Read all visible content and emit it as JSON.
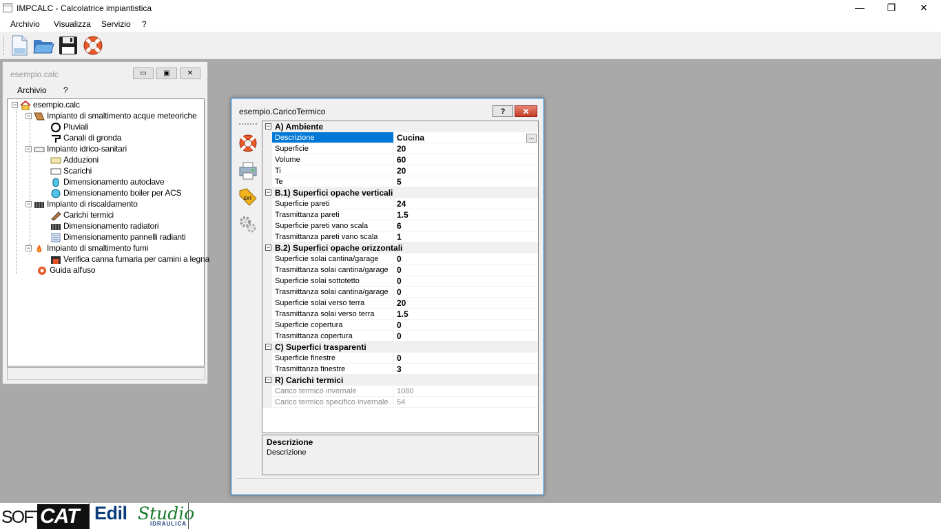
{
  "app": {
    "title": "IMPCALC - Calcolatrice impiantistica",
    "window_controls": {
      "minimize": "—",
      "restore": "❐",
      "close": "✕"
    }
  },
  "menu": [
    "Archivio",
    "Visualizza",
    "Servizio",
    "?"
  ],
  "toolbar": {
    "icons": [
      "new-file-icon",
      "open-folder-icon",
      "save-icon",
      "help-lifebuoy-icon"
    ]
  },
  "explorer": {
    "title": "esempio.calc",
    "menu": [
      "Archivio",
      "?"
    ],
    "tree": {
      "root": "esempio.calc",
      "n1": "Impianto di smaltimento acque meteoriche",
      "n1a": "Pluviali",
      "n1b": "Canali di gronda",
      "n2": "Impianto idrico-sanitari",
      "n2a": "Adduzioni",
      "n2b": "Scarichi",
      "n2c": "Dimensionamento autoclave",
      "n2d": "Dimensionamento boiler per ACS",
      "n3": "Impianto di riscaldamento",
      "n3a": "Carichi termici",
      "n3b": "Dimensionamento radiatori",
      "n3c": "Dimensionamento pannelli radianti",
      "n4": "Impianto di smaltimento fumi",
      "n4a": "Verifica canna fumaria per camini a legna",
      "n5": "Guida all'uso"
    }
  },
  "dialog": {
    "title": "esempio.CaricoTermico",
    "help": "?",
    "close": "✕",
    "ellipsis": "...",
    "categories": {
      "a": "A) Ambiente",
      "b1": "B.1) Superfici opache verticali",
      "b2": "B.2) Superfici opache orizzontali",
      "c": "C) Superfici trasparenti",
      "r": "R) Carichi termici"
    },
    "props": {
      "descrizione": {
        "name": "Descrizione",
        "value": "Cucina"
      },
      "superficie": {
        "name": "Superficie",
        "value": "20"
      },
      "volume": {
        "name": "Volume",
        "value": "60"
      },
      "ti": {
        "name": "Ti",
        "value": "20"
      },
      "te": {
        "name": "Te",
        "value": "5"
      },
      "sup_pareti": {
        "name": "Superficie pareti",
        "value": "24"
      },
      "tr_pareti": {
        "name": "Trasmittanza pareti",
        "value": "1.5"
      },
      "sup_pareti_vs": {
        "name": "Superficie pareti vano scala",
        "value": "6"
      },
      "tr_pareti_vs": {
        "name": "Trasmittanza pareti vano scala",
        "value": "1"
      },
      "sup_solai_cg": {
        "name": "Superficie solai cantina/garage",
        "value": "0"
      },
      "tr_solai_cg": {
        "name": "Trasmittanza solai cantina/garage",
        "value": "0"
      },
      "sup_solai_st": {
        "name": "Superficie solai sottotetto",
        "value": "0"
      },
      "tr_solai_cg2": {
        "name": "Trasmittanza solai cantina/garage",
        "value": "0"
      },
      "sup_solai_terra": {
        "name": "Superficie solai verso terra",
        "value": "20"
      },
      "tr_solai_terra": {
        "name": "Trasmittanza solai verso terra",
        "value": "1.5"
      },
      "sup_copertura": {
        "name": "Superficie copertura",
        "value": "0"
      },
      "tr_copertura": {
        "name": "Trasmittanza copertura",
        "value": "0"
      },
      "sup_finestre": {
        "name": "Superficie finestre",
        "value": "0"
      },
      "tr_finestre": {
        "name": "Trasmittanza finestre",
        "value": "3"
      },
      "carico_inv": {
        "name": "Carico termico invernale",
        "value": "1080"
      },
      "carico_spec": {
        "name": "Carico termico specifico invernale",
        "value": "54"
      }
    },
    "description_pane": {
      "title": "Descrizione",
      "text": "Descrizione"
    }
  },
  "logos": {
    "softcat_soft": "SOFT",
    "softcat_cat": "CAT",
    "edil": "Edil",
    "studio": "Studio",
    "idraulica": "IDRAULICA"
  },
  "colors": {
    "selection": "#0078d7",
    "desktop": "#a9a9a9",
    "close_red": "#c43c25"
  }
}
